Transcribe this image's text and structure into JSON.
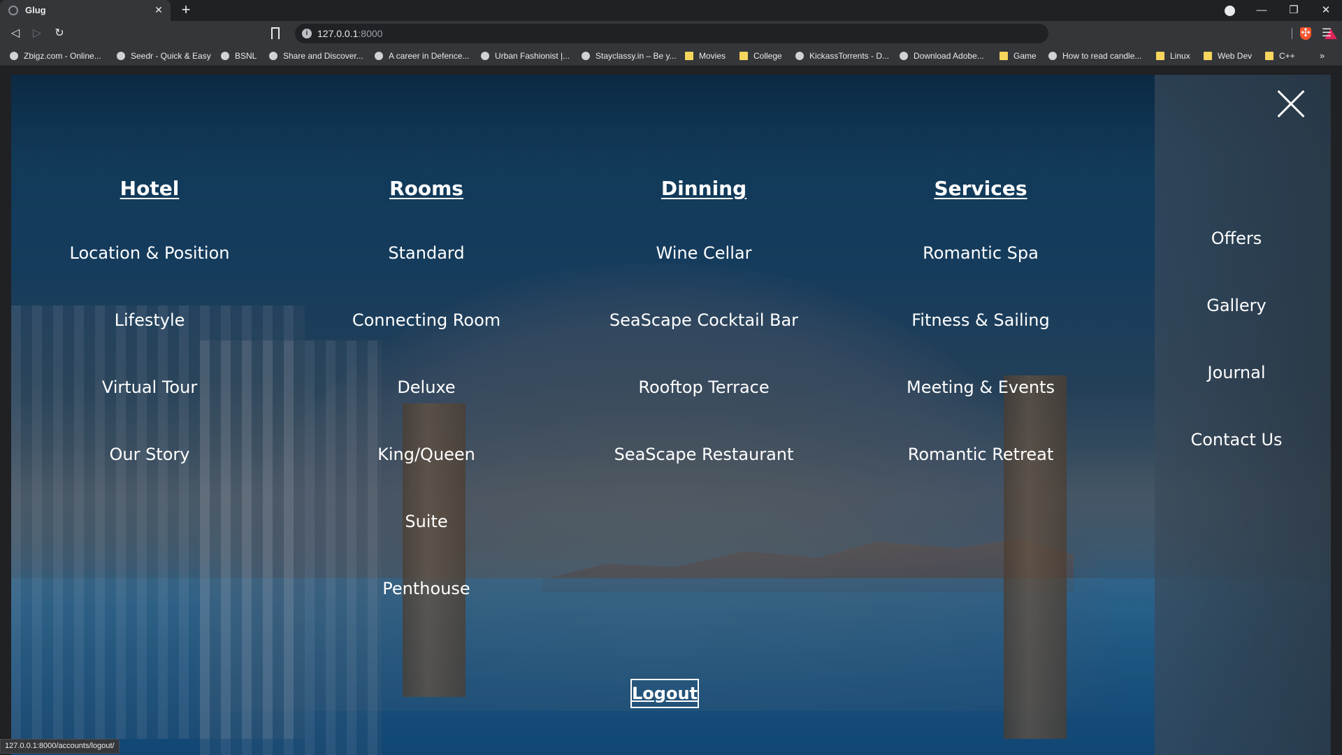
{
  "browser": {
    "tab_title": "Glug",
    "new_tab": "+",
    "url_host": "127.0.0.1",
    "url_port": ":8000",
    "bookmarks": [
      {
        "label": "Zbigz.com - Online...",
        "icon": "cloud-icon"
      },
      {
        "label": "Seedr - Quick & Easy",
        "icon": "seedr-icon"
      },
      {
        "label": "BSNL",
        "icon": "bsnl-icon"
      },
      {
        "label": "Share and Discover...",
        "icon": "share-icon"
      },
      {
        "label": "A career in Defence...",
        "icon": "globe-icon"
      },
      {
        "label": "Urban Fashionist |...",
        "icon": "globe-icon"
      },
      {
        "label": "Stayclassy.in – Be y...",
        "icon": "stayclassy-icon"
      },
      {
        "label": "Movies",
        "icon": "folder-icon"
      },
      {
        "label": "College",
        "icon": "folder-icon"
      },
      {
        "label": "KickassTorrents - D...",
        "icon": "kickass-icon"
      },
      {
        "label": "Download Adobe...",
        "icon": "download-icon"
      },
      {
        "label": "Game",
        "icon": "folder-icon"
      },
      {
        "label": "How to read candle...",
        "icon": "google-icon"
      },
      {
        "label": "Linux",
        "icon": "folder-icon"
      },
      {
        "label": "Web Dev",
        "icon": "folder-icon"
      },
      {
        "label": "C++",
        "icon": "folder-icon"
      }
    ],
    "bookmarks_more": "»",
    "status_url": "127.0.0.1:8000/accounts/logout/"
  },
  "menu": {
    "columns": [
      {
        "heading": "Hotel",
        "items": [
          "Location & Position",
          "Lifestyle",
          "Virtual Tour",
          "Our Story"
        ]
      },
      {
        "heading": "Rooms",
        "items": [
          "Standard",
          "Connecting Room",
          "Deluxe",
          "King/Queen",
          "Suite",
          "Penthouse"
        ]
      },
      {
        "heading": "Dinning",
        "items": [
          "Wine Cellar",
          "SeaScape Cocktail Bar",
          "Rooftop Terrace",
          "SeaScape Restaurant"
        ]
      },
      {
        "heading": "Services",
        "items": [
          "Romantic Spa",
          "Fitness & Sailing",
          "Meeting & Events",
          "Romantic Retreat"
        ]
      }
    ],
    "side_links": [
      "Offers",
      "Gallery",
      "Journal",
      "Contact Us"
    ],
    "logout_label": "Logout"
  }
}
